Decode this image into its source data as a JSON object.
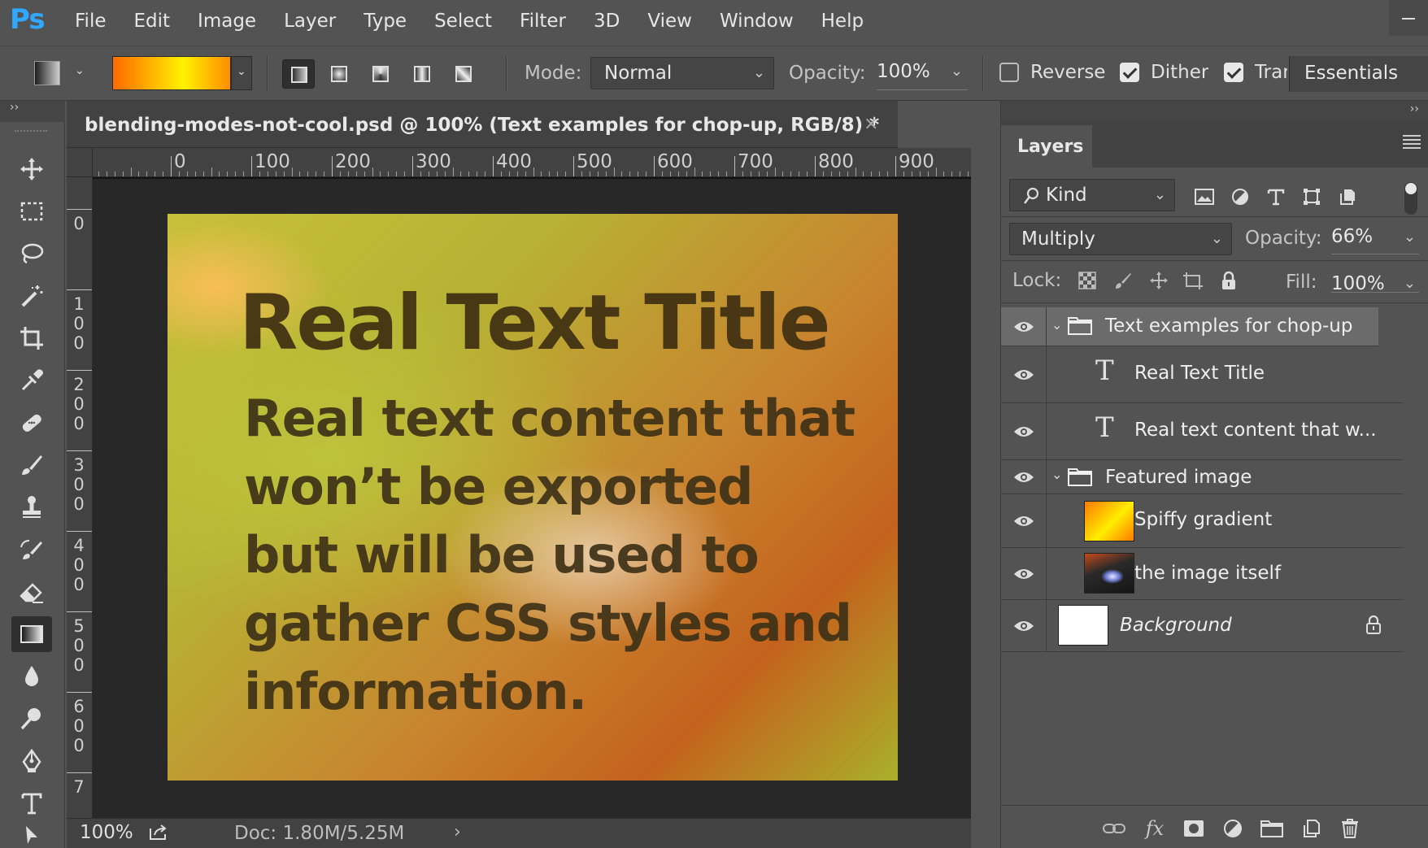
{
  "app": {
    "logo": "Ps"
  },
  "menu": [
    "File",
    "Edit",
    "Image",
    "Layer",
    "Type",
    "Select",
    "Filter",
    "3D",
    "View",
    "Window",
    "Help"
  ],
  "options_bar": {
    "mode_label": "Mode:",
    "mode_value": "Normal",
    "opacity_label": "Opacity:",
    "opacity_value": "100%",
    "reverse_label": "Reverse",
    "reverse_checked": false,
    "dither_label": "Dither",
    "dither_checked": true,
    "transparency_label": "Tran",
    "transparency_checked": true,
    "workspace": "Essentials",
    "gradient_colors": [
      "#ff6a00",
      "#ffd000",
      "#fff200",
      "#ff8c00"
    ]
  },
  "toolbar": {
    "tools": [
      "move-tool",
      "marquee-tool",
      "lasso-tool",
      "magic-wand-tool",
      "crop-tool",
      "eyedropper-tool",
      "healing-brush-tool",
      "brush-tool",
      "clone-stamp-tool",
      "history-brush-tool",
      "eraser-tool",
      "gradient-tool",
      "blur-tool",
      "dodge-tool",
      "pen-tool",
      "type-tool",
      "path-selection-tool"
    ],
    "active_tool": "gradient-tool"
  },
  "document": {
    "tab_title": "blending-modes-not-cool.psd @ 100% (Text examples for chop-up, RGB/8) *",
    "close_glyph": "×",
    "ruler_h_labels": [
      "0",
      "100",
      "200",
      "300",
      "400",
      "500",
      "600",
      "700",
      "800",
      "900"
    ],
    "ruler_v_labels": [
      "0",
      "100",
      "200",
      "300",
      "400",
      "500",
      "600",
      "7"
    ],
    "canvas": {
      "title_text": "Real Text Title",
      "body_text": "Real text content that won’t be exported but will be used to gather CSS styles and information."
    }
  },
  "status": {
    "zoom": "100%",
    "doc_info": "Doc: 1.80M/5.25M",
    "arrow": "›"
  },
  "layers_panel": {
    "tab_label": "Layers",
    "filter_kind": "Kind",
    "blend_mode": "Multiply",
    "opacity_label": "Opacity:",
    "opacity_value": "66%",
    "lock_label": "Lock:",
    "fill_label": "Fill:",
    "fill_value": "100%",
    "layers": [
      {
        "name": "Text examples for chop-up",
        "type": "group",
        "expanded": true,
        "selected": true,
        "indent": 0
      },
      {
        "name": "Real Text Title",
        "type": "text",
        "indent": 1
      },
      {
        "name": "Real text content that w...",
        "type": "text",
        "indent": 1
      },
      {
        "name": "Featured image",
        "type": "group",
        "expanded": true,
        "indent": 0
      },
      {
        "name": "Spiffy gradient",
        "type": "gradient",
        "indent": 1
      },
      {
        "name": "the image itself",
        "type": "image",
        "indent": 1
      },
      {
        "name": "Background",
        "type": "background",
        "locked": true,
        "indent": 0
      }
    ],
    "bottom_icons": [
      "link-layers-icon",
      "fx-icon",
      "add-mask-icon",
      "adjustment-layer-icon",
      "new-group-icon",
      "new-layer-icon",
      "delete-layer-icon"
    ],
    "fx_text": "fx"
  }
}
